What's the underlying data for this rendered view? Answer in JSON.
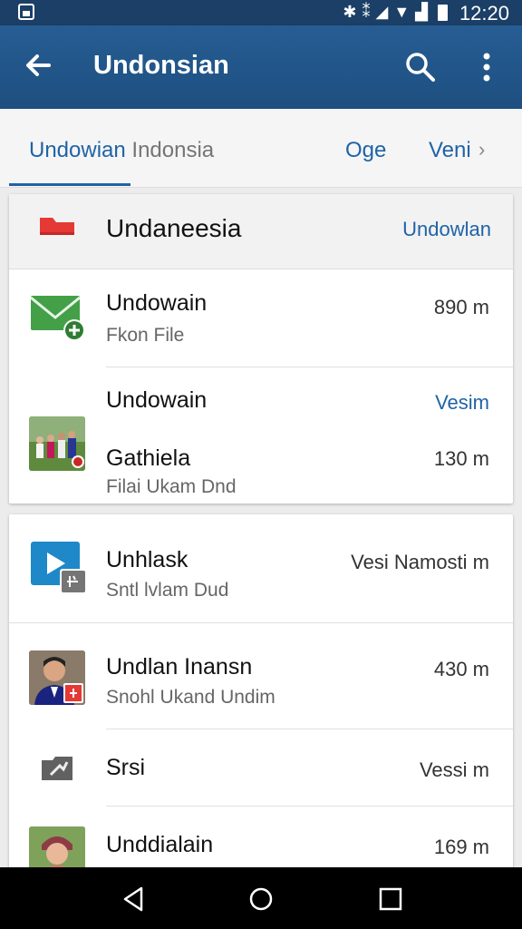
{
  "status_bar": {
    "time": "12:20",
    "icons": [
      "bluetooth-icon",
      "vibrate-icon",
      "signal-icon",
      "wifi-icon",
      "battery-icon"
    ]
  },
  "app_bar": {
    "title": "Undonsian",
    "icons": [
      "back-arrow-icon",
      "search-icon",
      "more-vert-icon"
    ]
  },
  "tabs": [
    {
      "label": "Undowian",
      "label_muted": " Indonsia",
      "selected": true
    },
    {
      "label": "Oge",
      "selected": false
    },
    {
      "label": "Veni",
      "selected": false
    }
  ],
  "cards": [
    {
      "header": {
        "title": "Undaneesia",
        "link": "Undowlan"
      },
      "items": [
        {
          "primary": "Undowain",
          "secondary": "Fkon File",
          "meta": "890 m",
          "icon": "mail-add-icon"
        },
        {
          "primary": "Undowain",
          "primary2": "Gathiela",
          "secondary": "Filai Ukam Dnd",
          "meta_top": "Vesim",
          "meta": "130 m",
          "icon": "group-photo-thumbnail"
        }
      ]
    },
    {
      "items": [
        {
          "primary": "Unhlask",
          "secondary": "Sntl lvlam Dud",
          "meta": "Vesi Namosti m",
          "icon": "video-icon"
        },
        {
          "primary": "Undlan Inansn",
          "secondary": "Snohl Ukand Undim",
          "meta": "430 m",
          "icon": "person-photo-thumbnail"
        },
        {
          "primary": "Srsi",
          "meta": "Vessi m",
          "icon": "folder-shared-icon"
        },
        {
          "primary": "Unddialain",
          "meta": "169 m",
          "icon": "person-photo-thumbnail"
        }
      ]
    }
  ],
  "colors": {
    "app_bar": "#1e4f80",
    "status_bar": "#1b3f66",
    "accent": "#1f63a6",
    "folder": "#e53935",
    "mail": "#43a047",
    "video": "#1e88c8"
  }
}
